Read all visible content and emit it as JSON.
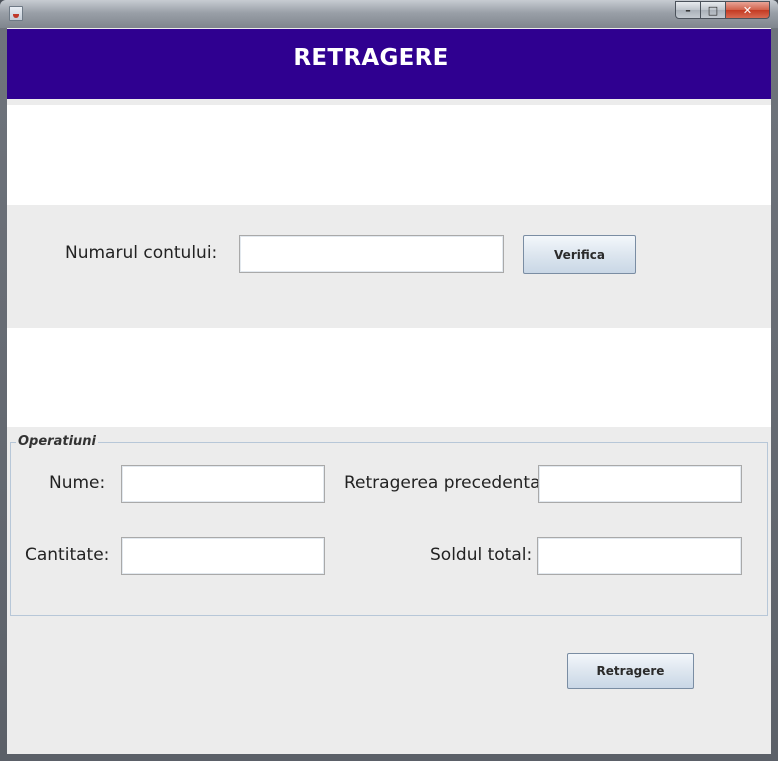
{
  "window": {
    "title": "",
    "controls": {
      "minimize": "–",
      "maximize": "□",
      "close": "✕"
    }
  },
  "header": {
    "title": "RETRAGERE"
  },
  "account": {
    "label": "Numarul contului:",
    "value": "",
    "verify_button": "Verifica"
  },
  "operations": {
    "legend": "Operatiuni",
    "name_label": "Nume:",
    "name_value": "",
    "previous_withdrawal_label": "Retragerea precedenta:",
    "previous_withdrawal_value": "",
    "quantity_label": "Cantitate:",
    "quantity_value": "",
    "total_balance_label": "Soldul total:",
    "total_balance_value": ""
  },
  "actions": {
    "withdraw_button": "Retragere"
  },
  "colors": {
    "header_bg": "#2f0090",
    "header_text": "#ffffff",
    "panel_bg": "#ececec"
  }
}
